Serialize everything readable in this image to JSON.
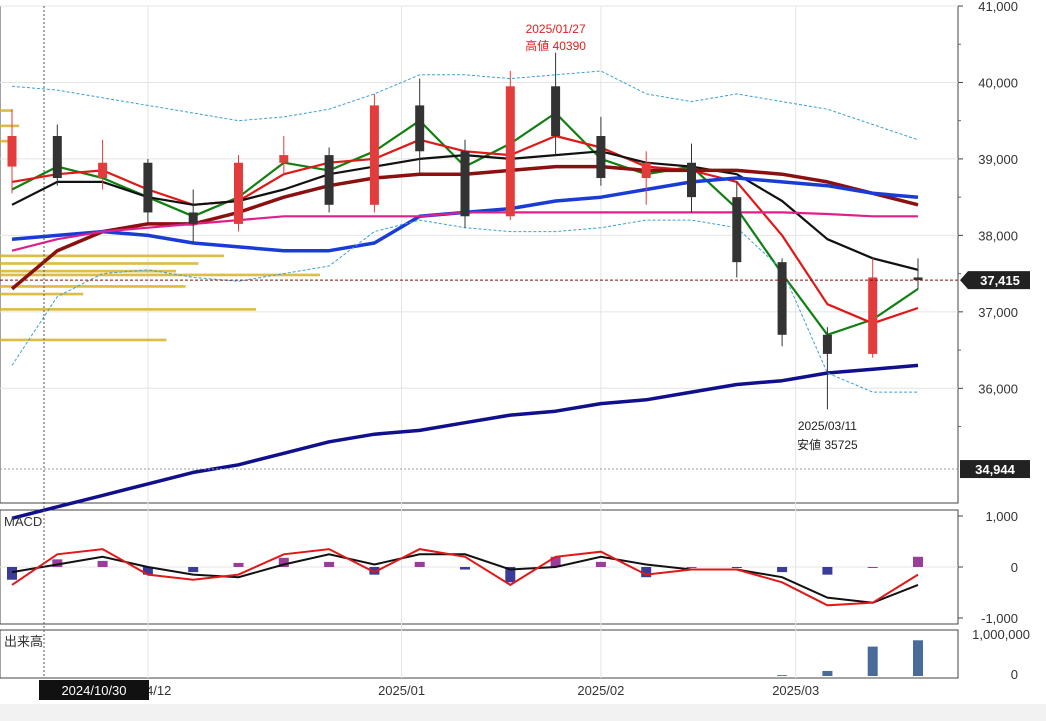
{
  "chart_data": [
    {
      "type": "candlestick",
      "title": "",
      "x": [
        "2024-10-30",
        "2024-11-05",
        "2024-11-12",
        "2024-11-19",
        "2024-11-26",
        "2024-12-03",
        "2024-12-10",
        "2024-12-17",
        "2024-12-24",
        "2025-01-06",
        "2025-01-14",
        "2025-01-21",
        "2025-01-27",
        "2025-02-03",
        "2025-02-10",
        "2025-02-17",
        "2025-02-25",
        "2025-03-03",
        "2025-03-10",
        "2025-03-17",
        "2025-03-24"
      ],
      "price_axis": {
        "ylim": [
          34500,
          41000
        ],
        "ticks": [
          "41,000",
          "40,000",
          "39,000",
          "38,000",
          "37,000",
          "36,000"
        ]
      },
      "x_ticks": [
        "2024/12",
        "2025/01",
        "2025/02",
        "2025/03"
      ],
      "cursor_label": "2024/10/30",
      "current_price_label": "37,415",
      "lower_price_label": "34,944",
      "annotations": [
        {
          "date": "2025/01/27",
          "text": "高値 40390",
          "color": "#e02020"
        },
        {
          "date": "2025/03/11",
          "text": "安値 35725",
          "color": "#222222"
        }
      ],
      "candles": [
        [
          38900,
          39650,
          38550,
          39300
        ],
        [
          39300,
          39450,
          38650,
          38750
        ],
        [
          38750,
          39250,
          38600,
          38950
        ],
        [
          38950,
          39000,
          38150,
          38300
        ],
        [
          38300,
          38600,
          37900,
          38150
        ],
        [
          38150,
          39050,
          38050,
          38950
        ],
        [
          38950,
          39300,
          38800,
          39050
        ],
        [
          39050,
          39150,
          38300,
          38400
        ],
        [
          38400,
          39850,
          38300,
          39700
        ],
        [
          39700,
          40050,
          38800,
          39100
        ],
        [
          39100,
          39250,
          38100,
          38250
        ],
        [
          38250,
          40150,
          38200,
          39950
        ],
        [
          39950,
          40390,
          39050,
          39300
        ],
        [
          39300,
          39550,
          38650,
          38750
        ],
        [
          38750,
          39100,
          38400,
          38950
        ],
        [
          38950,
          39200,
          38300,
          38500
        ],
        [
          38500,
          38700,
          37450,
          37650
        ],
        [
          37650,
          37700,
          36550,
          36700
        ],
        [
          36700,
          36800,
          35725,
          36450
        ],
        [
          36450,
          37700,
          36400,
          37450
        ],
        [
          37450,
          37700,
          37300,
          37415
        ]
      ],
      "series": [
        {
          "name": "",
          "color": "#108010",
          "values": [
            38600,
            38900,
            38750,
            38500,
            38250,
            38500,
            38950,
            38850,
            39100,
            39500,
            38900,
            39200,
            39600,
            39000,
            38800,
            38900,
            38350,
            37500,
            36700,
            36900,
            37300
          ]
        },
        {
          "name": "",
          "color": "#e01818",
          "values": [
            38700,
            38800,
            38850,
            38600,
            38400,
            38450,
            38800,
            38950,
            39000,
            39250,
            39100,
            39050,
            39300,
            39150,
            38900,
            38850,
            38700,
            38000,
            37100,
            36850,
            37050
          ]
        },
        {
          "name": "",
          "color": "#111111",
          "values": [
            38400,
            38700,
            38700,
            38500,
            38400,
            38450,
            38600,
            38800,
            38900,
            39000,
            39050,
            39000,
            39050,
            39100,
            38950,
            38900,
            38800,
            38450,
            37950,
            37700,
            37550
          ]
        },
        {
          "name": "",
          "color": "#8b1010",
          "values": [
            37300,
            37800,
            38050,
            38150,
            38150,
            38300,
            38500,
            38650,
            38750,
            38800,
            38800,
            38850,
            38900,
            38900,
            38850,
            38850,
            38850,
            38800,
            38700,
            38550,
            38400
          ]
        },
        {
          "name": "",
          "color": "#1a3cd6",
          "values": [
            37950,
            38000,
            38050,
            38000,
            37900,
            37850,
            37800,
            37800,
            37900,
            38250,
            38300,
            38350,
            38450,
            38500,
            38600,
            38700,
            38750,
            38700,
            38650,
            38550,
            38500
          ]
        },
        {
          "name": "",
          "color": "#e0208a",
          "values": [
            37800,
            37950,
            38050,
            38100,
            38150,
            38200,
            38250,
            38250,
            38250,
            38250,
            38300,
            38300,
            38300,
            38300,
            38300,
            38300,
            38300,
            38300,
            38280,
            38250,
            38250
          ]
        },
        {
          "name": "",
          "color": "#10108c",
          "values": [
            34300,
            34450,
            34600,
            34750,
            34900,
            35000,
            35150,
            35300,
            35400,
            35450,
            35550,
            35650,
            35700,
            35800,
            35850,
            35950,
            36050,
            36100,
            36200,
            36250,
            36300
          ]
        },
        {
          "name": "",
          "color": "#3aa0d8",
          "dashed": true,
          "values": [
            39950,
            39900,
            39800,
            39700,
            39600,
            39500,
            39550,
            39650,
            39850,
            40100,
            40100,
            40050,
            40100,
            40150,
            39850,
            39750,
            39850,
            39750,
            39650,
            39450,
            39250
          ]
        },
        {
          "name": "",
          "color": "#3aa0d8",
          "dashed": true,
          "values": [
            36300,
            37200,
            37500,
            37550,
            37450,
            37400,
            37500,
            37600,
            38050,
            38200,
            38100,
            38050,
            38050,
            38100,
            38200,
            38200,
            38100,
            37550,
            36200,
            35950,
            35950
          ]
        }
      ],
      "volume_profile": [
        {
          "price": 37700,
          "width": 0.7
        },
        {
          "price": 37600,
          "width": 0.62
        },
        {
          "price": 37500,
          "width": 0.55
        },
        {
          "price": 37450,
          "width": 1.0
        },
        {
          "price": 37300,
          "width": 0.58
        },
        {
          "price": 37200,
          "width": 0.26
        },
        {
          "price": 37000,
          "width": 0.8
        },
        {
          "price": 36600,
          "width": 0.52
        },
        {
          "price": 39600,
          "width": 0.04
        },
        {
          "price": 39400,
          "width": 0.06
        },
        {
          "price": 39200,
          "width": 0.05
        }
      ]
    },
    {
      "type": "bar+line",
      "title": "MACD",
      "ylim": [
        -1000,
        1000
      ],
      "y_ticks": [
        "1,000",
        "0",
        "-1,000"
      ],
      "macd": [
        -350,
        250,
        350,
        -150,
        -250,
        -150,
        250,
        350,
        -100,
        350,
        200,
        -350,
        200,
        300,
        -150,
        -50,
        -50,
        -300,
        -750,
        -700,
        -150
      ],
      "signal": [
        -100,
        50,
        200,
        0,
        -150,
        -200,
        50,
        250,
        50,
        250,
        250,
        -50,
        0,
        200,
        50,
        -50,
        -50,
        -200,
        -600,
        -700,
        -350
      ],
      "histogram": [
        -250,
        150,
        120,
        -150,
        -100,
        80,
        180,
        100,
        -150,
        100,
        -50,
        -300,
        200,
        100,
        -200,
        0,
        -20,
        -100,
        -150,
        0,
        200
      ]
    },
    {
      "type": "bar",
      "title": "出来高",
      "ylim": [
        0,
        1000000
      ],
      "y_ticks": [
        "1,000,000",
        "0"
      ],
      "values": [
        0,
        0,
        0,
        0,
        0,
        0,
        0,
        0,
        0,
        0,
        0,
        0,
        0,
        0,
        0,
        0,
        0,
        20000,
        120000,
        700000,
        850000
      ]
    }
  ]
}
